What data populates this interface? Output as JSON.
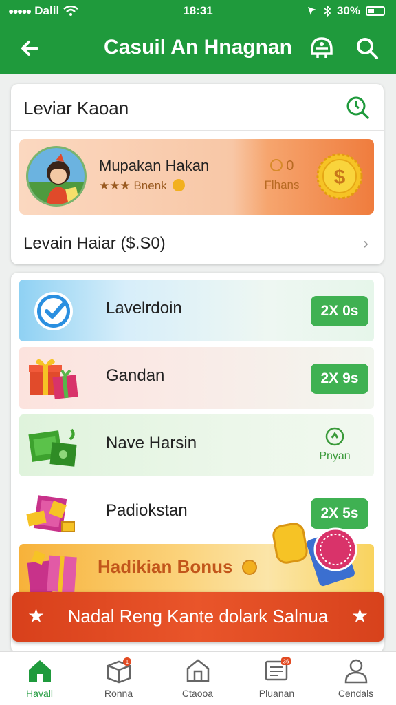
{
  "status_bar": {
    "carrier": "Dalil",
    "time": "18:31",
    "battery": "30%"
  },
  "app_bar": {
    "title": "Casuil An Hnagnan"
  },
  "top_card": {
    "header_title": "Leviar Kaoan",
    "profile": {
      "name": "Mupakan Hakan",
      "subtitle": "★★★ Bnenk",
      "coins_value": "0",
      "coins_label": "Flhans"
    },
    "row_label": "Levain Haiar ($.S0)"
  },
  "list": {
    "items": [
      {
        "label": "Lavelrdoin",
        "badge": "2X 0s"
      },
      {
        "label": "Gandan",
        "badge": "2X 9s"
      },
      {
        "label": "Nave Harsin",
        "action_label": "Pnyan"
      },
      {
        "label": "Padiokstan",
        "badge": "2X 5s"
      }
    ],
    "bonus_label": "Hadikian Bonus"
  },
  "banner": {
    "text": "Nadal Reng Kante dolark Salnua"
  },
  "bottom_nav": {
    "tabs": [
      {
        "label": "Havall",
        "active": true
      },
      {
        "label": "Ronna",
        "badge": "1"
      },
      {
        "label": "Ctaooa"
      },
      {
        "label": "Pluanan",
        "badge": "36"
      },
      {
        "label": "Cendals"
      }
    ]
  },
  "colors": {
    "primary_green": "#1f9a3c",
    "badge_green": "#3fb152",
    "banner_red": "#e24a22",
    "bonus_orange": "#c2561b"
  }
}
